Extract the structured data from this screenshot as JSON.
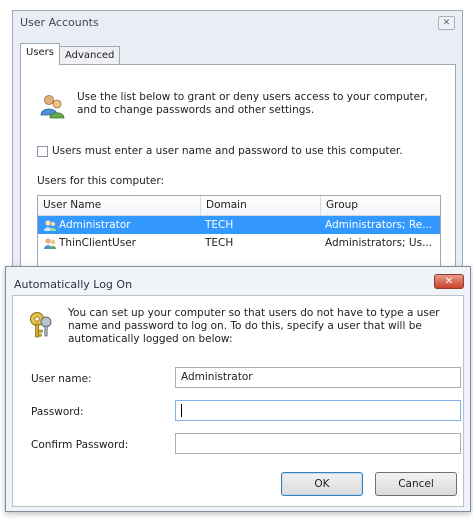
{
  "window": {
    "title": "User Accounts",
    "close_glyph": "✕"
  },
  "tabs": [
    {
      "label": "Users",
      "active": true
    },
    {
      "label": "Advanced",
      "active": false
    }
  ],
  "users_tab": {
    "icon": "users-icon",
    "intro_line1": "Use the list below to grant or deny users access to your computer,",
    "intro_line2": "and to change passwords and other settings.",
    "checkbox_label": "Users must enter a user name and password to use this computer.",
    "checkbox_checked": false,
    "list_label": "Users for this computer:",
    "columns": [
      "User Name",
      "Domain",
      "Group"
    ],
    "rows": [
      {
        "user": "Administrator",
        "domain": "TECH",
        "group": "Administrators; Re...",
        "selected": true
      },
      {
        "user": "ThinClientUser",
        "domain": "TECH",
        "group": "Administrators; Us...",
        "selected": false
      }
    ]
  },
  "dialog": {
    "title": "Automatically Log On",
    "close_glyph": "✕",
    "icon": "keys-icon",
    "message_line1": "You can set up your computer so that users do not have to type a user",
    "message_line2": "name and password to log on. To do this, specify a user that will be",
    "message_line3": "automatically logged on below:",
    "fields": {
      "username_label": "User name:",
      "username_value": "Administrator",
      "password_label": "Password:",
      "password_value": "",
      "confirm_label": "Confirm Password:",
      "confirm_value": ""
    },
    "ok_label": "OK",
    "cancel_label": "Cancel"
  },
  "colors": {
    "selection": "#3399ff",
    "window_bg": "#e9eef4",
    "close_red": "#c8432c"
  }
}
